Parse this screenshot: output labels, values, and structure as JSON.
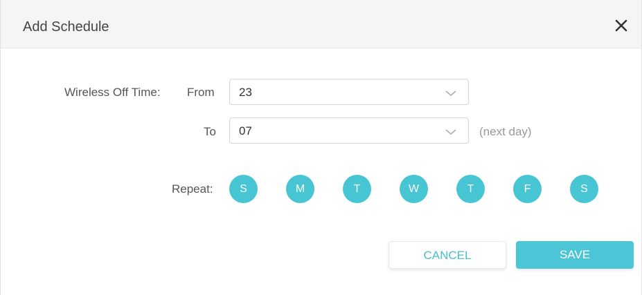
{
  "dialog": {
    "title": "Add Schedule",
    "close_icon": "close-icon"
  },
  "form": {
    "wireless_off_time_label": "Wireless Off Time:",
    "from_label": "From",
    "from_value": "23",
    "to_label": "To",
    "to_value": "07",
    "to_hint": "(next day)",
    "repeat_label": "Repeat:",
    "days": [
      {
        "label": "S",
        "selected": true
      },
      {
        "label": "M",
        "selected": true
      },
      {
        "label": "T",
        "selected": true
      },
      {
        "label": "W",
        "selected": true
      },
      {
        "label": "T",
        "selected": true
      },
      {
        "label": "F",
        "selected": true
      },
      {
        "label": "S",
        "selected": true
      }
    ]
  },
  "buttons": {
    "cancel": "CANCEL",
    "save": "SAVE"
  },
  "colors": {
    "accent": "#47c5d3",
    "header_bg": "#f5f5f5"
  }
}
